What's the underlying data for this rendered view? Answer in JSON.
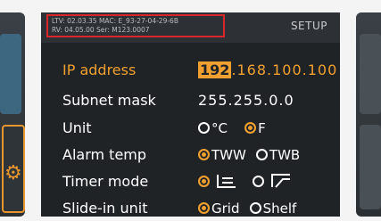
{
  "header": {
    "info_line1": "LTV: 02.03.35 MAC: E_93-27-04-29-6B",
    "info_line2": "RV: 04.05.00 Ser: M123.0007",
    "setup_label": "SETUP"
  },
  "settings": {
    "ip_address": {
      "label": "IP address",
      "value_highlight": "192",
      "value_rest": ".168.100.100"
    },
    "subnet_mask": {
      "label": "Subnet mask",
      "value": "255.255.0.0"
    },
    "unit": {
      "label": "Unit",
      "options": [
        "°C",
        "F"
      ],
      "selected": "F"
    },
    "alarm_temp": {
      "label": "Alarm temp",
      "options": [
        "TWW",
        "TWB"
      ],
      "selected": "TWW"
    },
    "timer_mode": {
      "label": "Timer mode",
      "options": [
        "timer-mode-a-icon",
        "timer-mode-b-icon"
      ],
      "selected": "timer-mode-a-icon"
    },
    "slide_in_unit": {
      "label": "Slide-in unit",
      "options": [
        "Grid",
        "Shelf"
      ],
      "selected": "Grid"
    }
  },
  "colors": {
    "accent": "#f0a030",
    "screen_bg": "#202326",
    "highlight_box": "#d8262a"
  },
  "icons": {
    "left_panel": "gear-icon"
  }
}
